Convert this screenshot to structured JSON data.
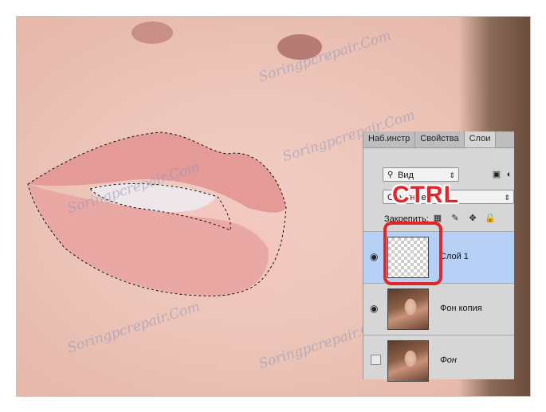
{
  "photo": {
    "subject": "lips-closeup",
    "watermark": "Soringpcrepair.Com",
    "selection": "marching-ants-lips-outline"
  },
  "annotation": {
    "label": "CTRL",
    "color": "#e0262a"
  },
  "layers_panel": {
    "tabs": [
      {
        "label": "Наб.инстр"
      },
      {
        "label": "Свойства"
      },
      {
        "label": "Слои"
      }
    ],
    "filter": {
      "value": "Вид"
    },
    "blend_mode": {
      "value": "Обычные"
    },
    "lock_label": "Закрепить:",
    "layers": [
      {
        "name": "Слой 1",
        "visible": true,
        "selected": true,
        "thumbnail": "transparent"
      },
      {
        "name": "Фон копия",
        "visible": true,
        "selected": false,
        "thumbnail": "portrait"
      },
      {
        "name": "Фон",
        "visible": false,
        "selected": false,
        "thumbnail": "portrait"
      }
    ],
    "selected_color": "#b6cff5"
  }
}
